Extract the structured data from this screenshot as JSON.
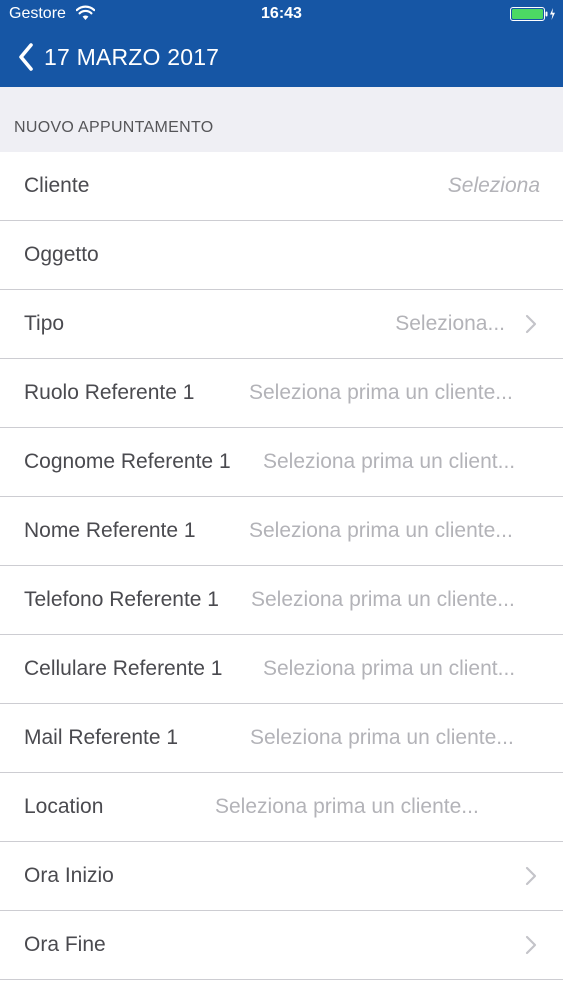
{
  "status_bar": {
    "carrier": "Gestore",
    "time": "16:43",
    "icons": [
      "wifi-icon",
      "battery-icon",
      "charging-icon"
    ],
    "battery_color": "#4cd964"
  },
  "nav_bar": {
    "back_label": "17 MARZO 2017",
    "color": "#1656a5"
  },
  "section": {
    "title": "NUOVO APPUNTAMENTO"
  },
  "rows": [
    {
      "label": "Cliente",
      "value": "Seleziona"
    },
    {
      "label": "Oggetto",
      "value": ""
    },
    {
      "label": "Tipo",
      "value": "Seleziona..."
    },
    {
      "label": "Ruolo Referente 1",
      "value": "Seleziona prima un cliente..."
    },
    {
      "label": "Cognome Referente 1",
      "value": "Seleziona prima un client..."
    },
    {
      "label": "Nome Referente 1",
      "value": "Seleziona prima un cliente..."
    },
    {
      "label": "Telefono Referente 1",
      "value": "Seleziona prima un cliente..."
    },
    {
      "label": "Cellulare Referente 1",
      "value": "Seleziona prima un client..."
    },
    {
      "label": "Mail Referente 1",
      "value": "Seleziona prima un cliente..."
    },
    {
      "label": "Location",
      "value": "Seleziona prima un cliente..."
    },
    {
      "label": "Ora Inizio",
      "value": ""
    },
    {
      "label": "Ora Fine",
      "value": ""
    }
  ]
}
